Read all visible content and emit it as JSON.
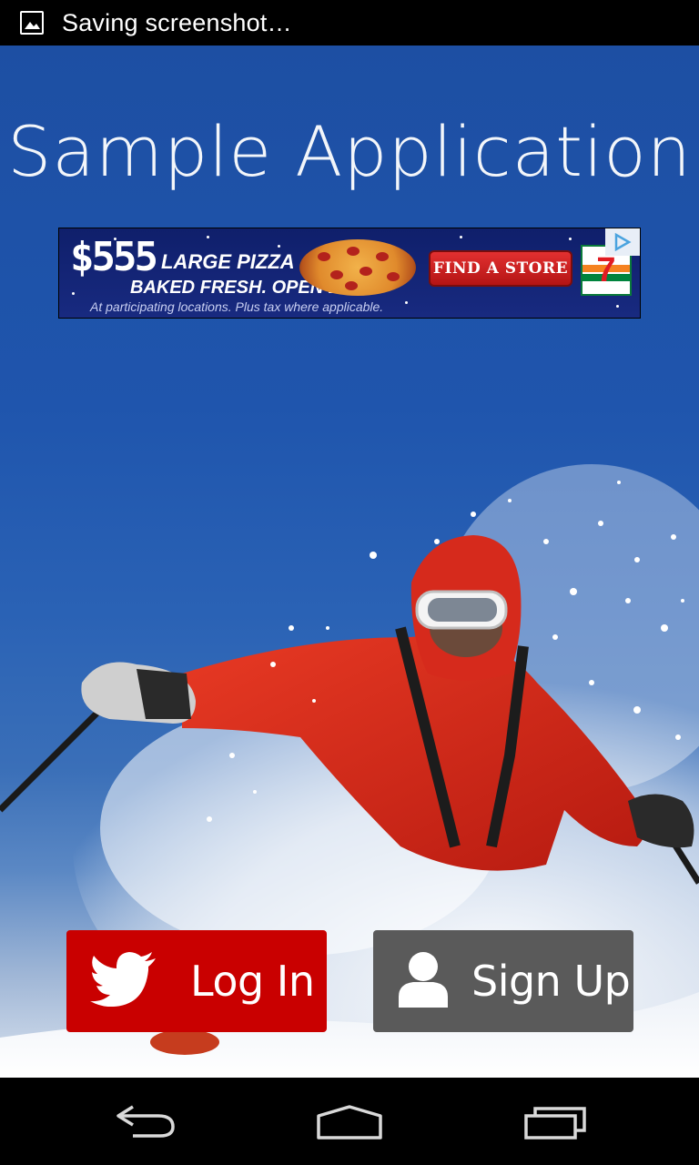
{
  "status_bar": {
    "notification_icon": "image-icon",
    "text": "Saving screenshot…"
  },
  "app": {
    "title": "Sample Application"
  },
  "ad": {
    "price": "$555",
    "line1": "LARGE PIZZA",
    "line2": "BAKED FRESH. OPEN LATE.",
    "fine_print": "At participating locations. Plus tax where applicable.",
    "cta": "FIND A STORE",
    "brand_icon": "7-eleven-logo",
    "adchoices_icon": "adchoices-icon"
  },
  "buttons": {
    "login_label": "Log In",
    "login_icon": "twitter-bird-icon",
    "signup_label": "Sign Up",
    "signup_icon": "user-icon"
  },
  "nav_bar": {
    "back": "back-icon",
    "home": "home-icon",
    "recents": "recent-apps-icon"
  },
  "colors": {
    "login_button": "#c90000",
    "signup_button": "#5a5a5a",
    "sky": "#1f55ad"
  }
}
